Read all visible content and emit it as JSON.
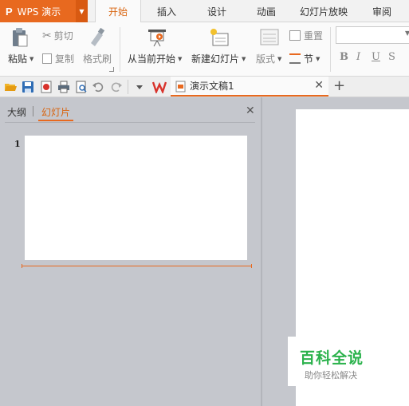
{
  "app": {
    "logo": "P",
    "title": "WPS 演示"
  },
  "tabs": [
    "开始",
    "插入",
    "设计",
    "动画",
    "幻灯片放映",
    "审阅"
  ],
  "ribbon": {
    "paste": "粘贴",
    "cut": "剪切",
    "copy": "复制",
    "format_painter": "格式刷",
    "from_current": "从当前开始",
    "new_slide": "新建幻灯片",
    "layout": "版式",
    "reset": "重置",
    "section": "节",
    "format_buttons": [
      "B",
      "I",
      "U",
      "S"
    ]
  },
  "document": {
    "tab_title": "演示文稿1"
  },
  "panel": {
    "outline_tab": "大纲",
    "slides_tab": "幻灯片",
    "slide_number": "1"
  },
  "watermark": {
    "title": "百科全说",
    "subtitle": "助你轻松解决"
  },
  "colors": {
    "accent": "#e8691f",
    "watermark_green": "#2bb24c"
  }
}
